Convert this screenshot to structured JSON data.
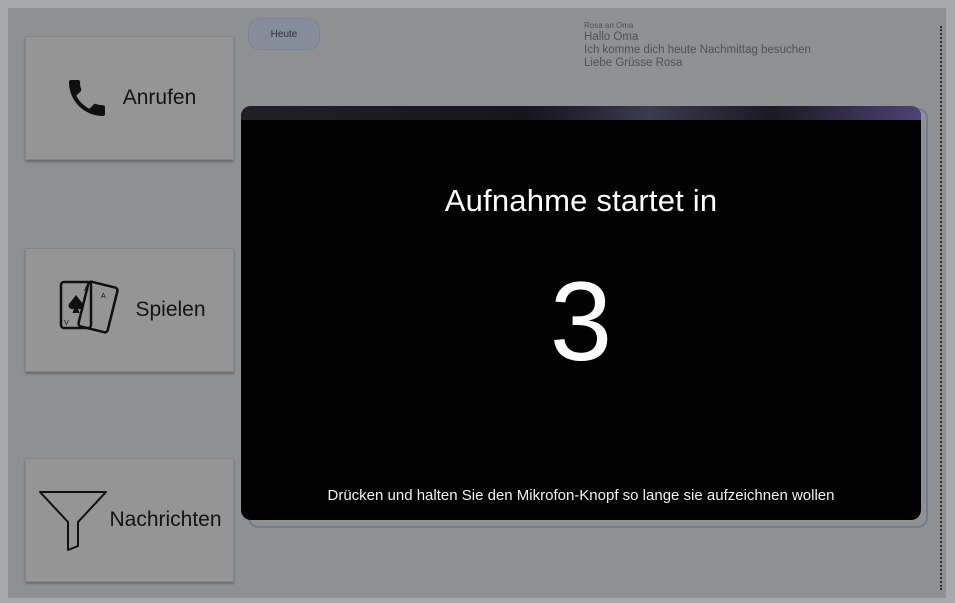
{
  "nav": {
    "call": {
      "label": "Anrufen",
      "icon": "phone-icon"
    },
    "games": {
      "label": "Spielen",
      "icon": "playing-cards-icon"
    },
    "messages": {
      "label": "Nachrichten",
      "icon": "filter-icon"
    }
  },
  "chat": {
    "date_chip": "Heute",
    "message": {
      "sender": "Rosa an Oma",
      "lines": [
        "Hallo Oma",
        "Ich komme dich heute Nachmittag besuchen",
        "Liebe Grüsse Rosa"
      ]
    }
  },
  "recording_overlay": {
    "title": "Aufnahme startet in",
    "countdown": "3",
    "hint": "Drücken und halten Sie den Mikrofon-Knopf so lange sie aufzeichnen wollen"
  },
  "colors": {
    "overlay_bg": "#000000",
    "date_chip_bg": "#d4dbf1",
    "button_bg": "#e9e9e9"
  }
}
